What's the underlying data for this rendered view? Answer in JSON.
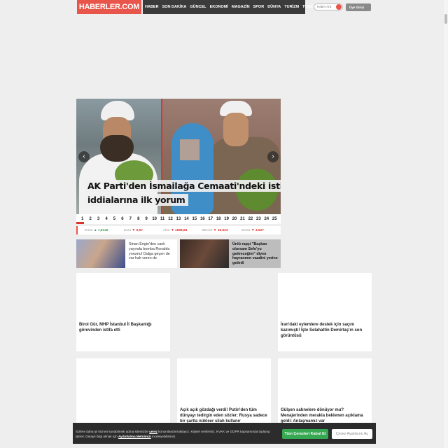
{
  "header": {
    "logo": "HABERLER.COM",
    "nav": [
      "HABER",
      "SON DAKİKA",
      "GÜNCEL",
      "EKONOMİ",
      "MAGAZİN",
      "SPOR",
      "DÜNYA",
      "TURİZM",
      "TÜMÜ"
    ],
    "search_placeholder": "Haber Ara",
    "login_label": "Üye Girişi"
  },
  "slider": {
    "headline_line1": "AK Parti'den İsmailağa Cemaati'ndeki istismar",
    "headline_line2": "iddialarına ilk yorum",
    "prev_label": "‹",
    "next_label": "›",
    "pages": [
      "1",
      "2",
      "3",
      "4",
      "5",
      "6",
      "7",
      "8",
      "9",
      "10",
      "11",
      "12",
      "13",
      "14",
      "15",
      "16",
      "17",
      "18",
      "19",
      "20",
      "21",
      "22",
      "23",
      "24",
      "25"
    ],
    "active_page": "1"
  },
  "markets": [
    {
      "name": "Dolar",
      "value": "7,8146",
      "trend": "up"
    },
    {
      "name": "Euro",
      "value": "9,57",
      "trend": "down"
    },
    {
      "name": "Altın",
      "value": "1868,84",
      "trend": "down"
    },
    {
      "name": "Bitcoin",
      "value": "19.623",
      "trend": "down"
    },
    {
      "name": "Borsa",
      "value": "4.627",
      "trend": "down"
    }
  ],
  "small_news": [
    {
      "text": "Sinan Engin'den canlı yayında bomba Ronaldo yorumu! Dalga geçen de var hak veren de"
    },
    {
      "text": "Ünlü rapçi \"Başkan olursam Sefo'yu getireceğim\" diyen hayranının vaadini yerine getirdi"
    }
  ],
  "cards": [
    {
      "title": "Birol Gür, MHP İstanbul İl Başkanlığı görevinden istifa etti"
    },
    {
      "title": ""
    },
    {
      "title": "İran'daki eylemlere destek için saçını kazımıştı! İşte Selahattin Demirtaş'ın son görüntüsü"
    },
    {
      "title": ""
    },
    {
      "title": "Açık açık gözdağı verdi! Putin'den tüm dünyayı tedirgin eden sözler: Rusya sadece bir şartla nükleer silah kullanır"
    },
    {
      "title": "Gülşen sahnelere dönüyor mu? Menajerinden merakla beklenen açıklama geldi: Anlaşmamız var"
    }
  ],
  "cookie": {
    "text_a": "Sizlere daha iyi hizmet sunabilmek adına sitemizde",
    "link1": "çerez",
    "text_b": "konumlandırmaktayız. Kişisel verileriniz, KVKK ve GDPR kapsamında toplanıp işlenir. Detaylı bilgi almak için",
    "link2": "Aydınlatma Metnimizi",
    "text_c": "inceleyebilirsiniz.",
    "accept_label": "Tüm Çerezleri Kabul Et",
    "settings_label": "Çerez Ayarlarını Aç"
  }
}
